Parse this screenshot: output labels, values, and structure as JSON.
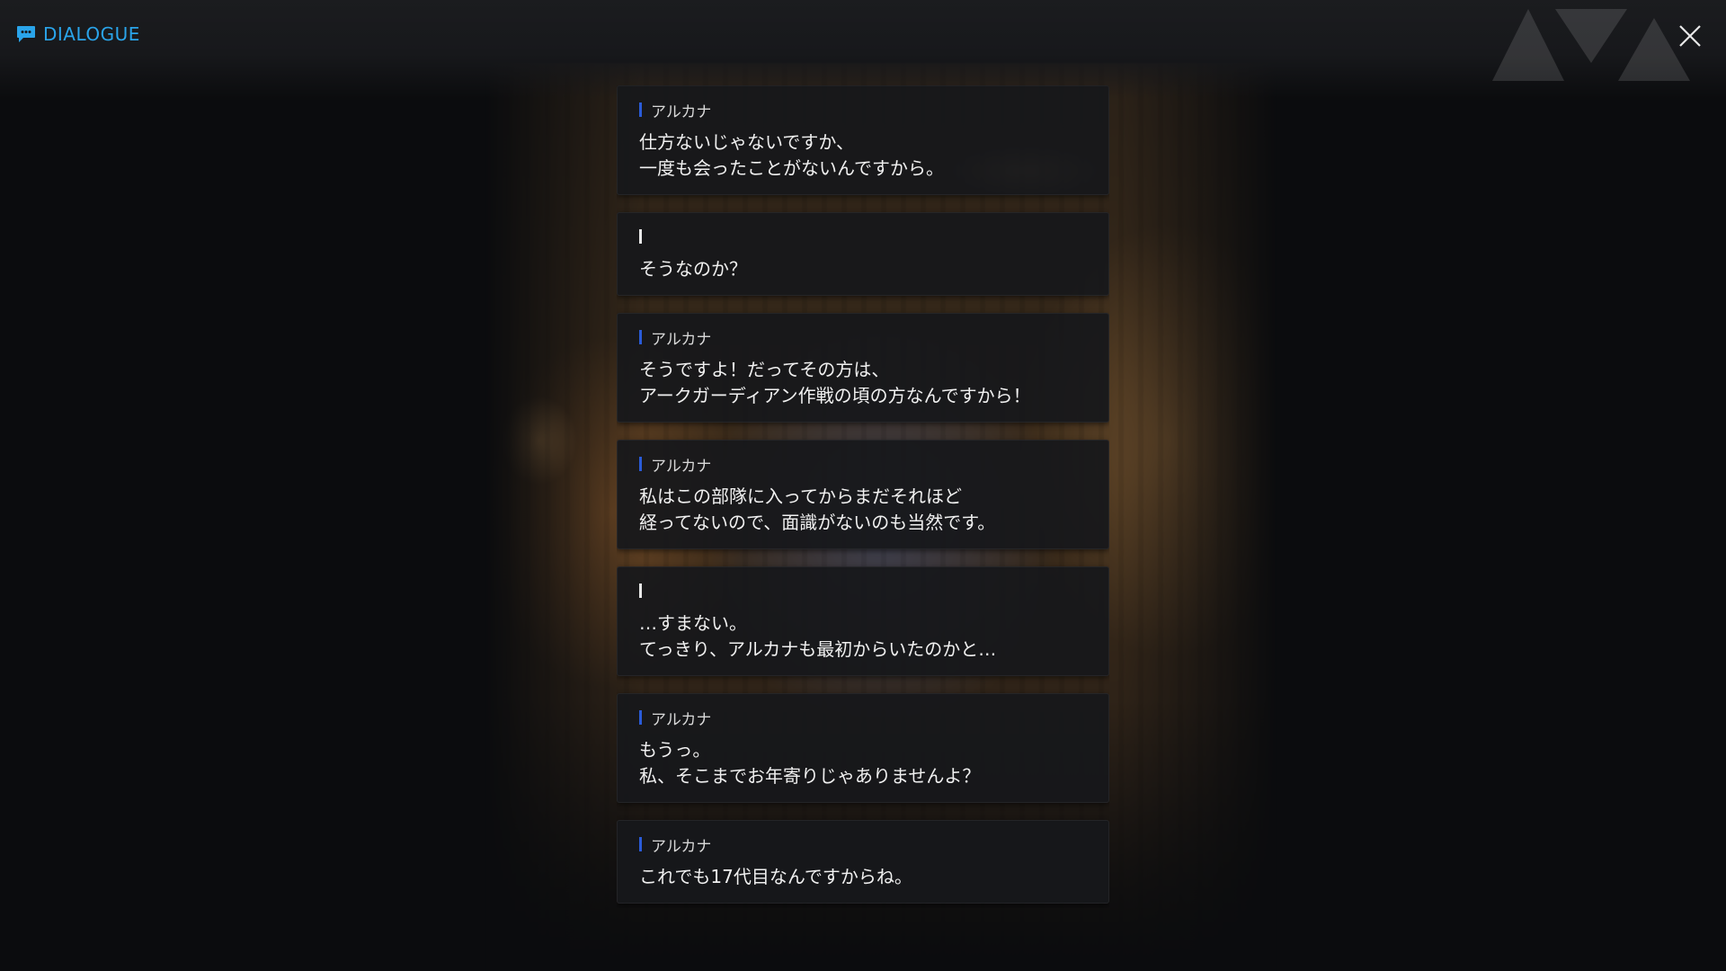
{
  "header": {
    "title": "DIALOGUE",
    "title_icon": "chat-bubble-icon",
    "close_icon": "close-icon",
    "accent_color": "#2aa4ea"
  },
  "dialogue": [
    {
      "speaker": "アルカナ",
      "lines": [
        "仕方ないじゃないですか、",
        "一度も会ったことがないんですから。"
      ]
    },
    {
      "speaker": "",
      "lines": [
        "そうなのか？"
      ]
    },
    {
      "speaker": "アルカナ",
      "lines": [
        "そうですよ！だってその方は、",
        "アークガーディアン作戦の頃の方なんですから！"
      ]
    },
    {
      "speaker": "アルカナ",
      "lines": [
        "私はこの部隊に入ってからまだそれほど",
        "経ってないので、面識がないのも当然です。"
      ]
    },
    {
      "speaker": "",
      "lines": [
        "…すまない。",
        "てっきり、アルカナも最初からいたのかと…"
      ]
    },
    {
      "speaker": "アルカナ",
      "lines": [
        "もうっ。",
        "私、そこまでお年寄りじゃありませんよ？"
      ]
    },
    {
      "speaker": "アルカナ",
      "lines": [
        "これでも17代目なんですからね。"
      ]
    }
  ]
}
